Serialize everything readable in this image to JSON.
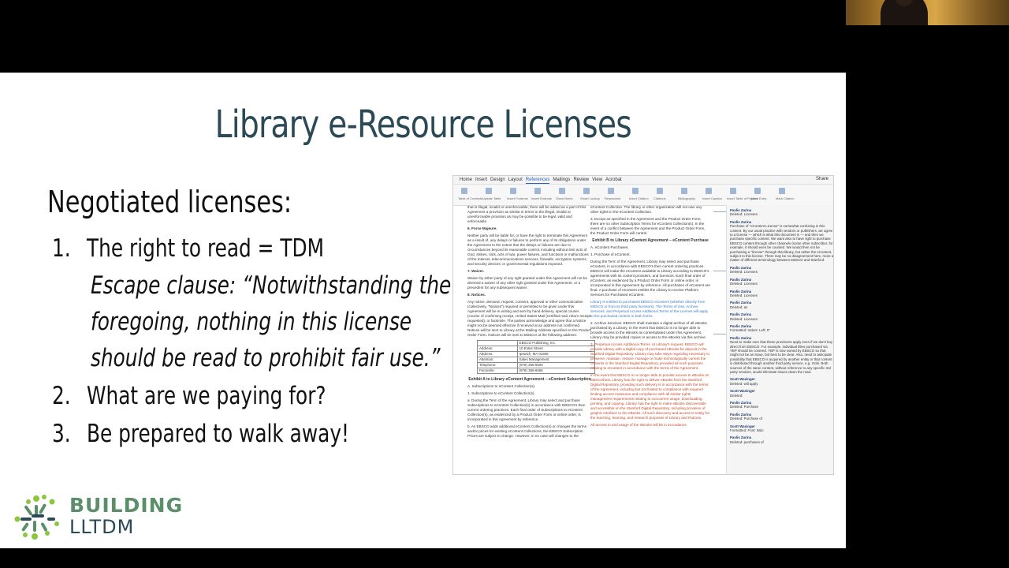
{
  "slide": {
    "title": "Library e-Resource Licenses",
    "heading": "Negotiated licenses:",
    "items": [
      {
        "num": "1.",
        "text": "The right to read = TDM"
      },
      {
        "num": "2.",
        "text": "What are we paying for?"
      },
      {
        "num": "3.",
        "text": "Be prepared to walk away!"
      }
    ],
    "escape_lines": [
      "Escape clause: “Notwithstanding the",
      "foregoing, nothing in this license",
      "should be read to prohibit fair use.”"
    ]
  },
  "logo": {
    "line1": "BUILDING",
    "line2": "LLTDM"
  },
  "document": {
    "tabs": [
      "Home",
      "Insert",
      "Design",
      "Layout",
      "References",
      "Mailings",
      "Review",
      "View",
      "Acrobat"
    ],
    "active_tab": "References",
    "share_label": "Share",
    "tool_labels": [
      "Table of Contents",
      "Update Table",
      "Insert Footnote",
      "Insert Endnote",
      "Show Notes",
      "Smart Lookup",
      "Researcher",
      "Insert Citation",
      "Citations",
      "Bibliography",
      "Insert Caption",
      "Insert Table of Figures",
      "Mark Entry",
      "Mark Citation"
    ],
    "left_col": [
      {
        "cls": "",
        "text": "that is illegal, invalid or unenforceable, there will be added as a part of this Agreement a provision as similar in terms to the illegal, invalid or unenforceable provision as may be possible to be legal, valid and enforceable."
      },
      {
        "cls": "b",
        "text": "6. Force Majeure."
      },
      {
        "cls": "",
        "text": "Neither party will be liable for, or have the right to terminate this Agreement as a result of, any delays or failures to perform any of its obligations under the Agreement to the extent that the delays or failures are due to circumstances beyond its reasonable control, including without limit acts of God, strikes, riots, acts of war, power failures, and functions or malfunctions of the Internet, telecommunications services, firewalls, encryption systems, and security devices; or governmental regulations imposed."
      },
      {
        "cls": "b",
        "text": "7. Waiver."
      },
      {
        "cls": "",
        "text": "Waiver by either party of any right granted under this Agreement will not be deemed a waiver of any other right granted under this Agreement, or a precedent for any subsequent waiver."
      },
      {
        "cls": "b",
        "text": "8. Notices."
      },
      {
        "cls": "",
        "text": "Any notice, demand, request, consent, approval or other communication (collectively, \"Notices\") required or permitted to be given under this Agreement will be in writing and sent by hand delivery, special courier (courier of confirming receipt, United States Mail (certified mail, return receipt requested), or facsimile. The parties acknowledge and agree that a Notice might not be deemed effective if received at an address not confirmed. Notices will be sent to Library at the Mailing Address specified on the Product Order Form. Notices will be sent to EBSCO at the following address:"
      }
    ],
    "address_rows": [
      [
        "",
        "EBSCO Publishing, Inc."
      ],
      [
        "Address:",
        "10 Estes Street"
      ],
      [
        "Address:",
        "Ipswich, MA 01938"
      ],
      [
        "Attention:",
        "Sales Management"
      ],
      [
        "Telephone:",
        "(978) 356-6500"
      ],
      [
        "Facsimile:",
        "(978) 356-6565"
      ]
    ],
    "left_col_2": [
      {
        "cls": "h",
        "text": "Exhibit A to Library eContent Agreement – eContent Subscription"
      },
      {
        "cls": "",
        "text": "A. Subscriptions to eContent Collection(s)."
      },
      {
        "cls": "",
        "text": "1. Subscriptions to eContent Collection(s)."
      },
      {
        "cls": "",
        "text": "a. During the Term of the Agreement, Library may select and purchase Subscriptions to eContent Collection(s) in accordance with EBSCO's then current ordering practices. Each final order of Subscriptions to eContent Collection(s), as evidenced by a Product Order Form or online order, is incorporated in this Agreement by reference."
      },
      {
        "cls": "",
        "text": "b. As EBSCO adds additional eContent Collection(s) or changes the terms and/or prices for existing eContent Collections, the EBSCO Subscription Prices are subject to change. However, in no case will changes to the"
      }
    ],
    "mid_col": [
      {
        "cls": "",
        "text": "eContent Collection. The library or other organization will not own any other rights in the eContent Collection."
      },
      {
        "cls": "",
        "text": "3. Except as specified in the Agreement and the Product Order Form, there are no other Subscription Terms for eContent Collection(s). In the event of a conflict between the Agreement and the Product Order Form, the Product Order Form will control."
      },
      {
        "cls": "h",
        "text": "Exhibit B to Library eContent Agreement – eContent Purchase"
      },
      {
        "cls": "",
        "text": "A. eContent Purchases."
      },
      {
        "cls": "",
        "text": "1. Purchase of eContent."
      },
      {
        "cls": "",
        "text": "During the Term of the Agreement, Library may select and purchase eContent, in accordance with EBSCO's then current ordering practices. EBSCO will make the eContent available to Library according to EBSCO's agreements with its content providers, and licensors. Each final order of eContent, as evidenced by a Product Order Form or online order, is incorporated in this Agreement by reference. All purchases of eContent are final. A purchase of eContent entitles the Library to receive Platform Services for Purchased eContent."
      },
      {
        "cls": "blue",
        "text": "Library is entitled to purchased EBSCO eContent (whether directly from EBSCO or from its third party licensors). The Terms of Use, Archive Services, and Perpetual Access Additional Terms of the License will apply to the purchased content in both forms."
      },
      {
        "cls": "",
        "text": "2. Archive Services. EBSCO shall maintain a digital archive of all eBooks purchased by a Library. In the event that EBSCO is no longer able to provide access to the eBooks as contemplated under this Agreement, Library may be provided copies or access to the eBooks via this archive."
      },
      {
        "cls": "red",
        "text": "3. Perpetual Access Additional Terms. At Library's request, EBSCO will provide Library with a digital copy of purchased eBooks for deposit in the Stanford Digital Repository. Library may take steps regarding necessary to preserve, maintain, restore, manage or make technologically current the contents in the Stanford Digital Repository, provided all such purposes relating to eContent in accordance with the terms of the Agreement."
      },
      {
        "cls": "red",
        "text": "In the event that EBSCO is no longer able to provide access to eBooks on EBSCOhost, Library has the right to deliver eBooks from the Stanford Digital Repository, providing such delivery is in accordance with the terms of the Agreement, including but not limited to compliance with required limiting access measures and compliance with all similar rights management requirements relating to concurrent usage, downloading, printing, and copying. Library has the right to make eBooks discoverable and accessible on the Stanford Digital Repository, including provision of graphic interface to the eBooks. All such discovery and access is solely for the teaching, learning, and research purposes of Library and Patrons."
      },
      {
        "cls": "red",
        "text": "All access to and usage of the eBooks will be in accordance"
      }
    ],
    "comments": [
      {
        "author": "Pavlis Zarina",
        "note": "Deleted: Licenses"
      },
      {
        "author": "Pavlis Zarina",
        "note": "Purchase of \"eContent License\" is somewhat confusing in this context. By our usual practice with vendors or publishers, we agree to a license — which is what this document is — and then we purchase specific content. We want also to have right to purchase EBSCO content through other channels (some other subscriber, for example, it should even be counted. We would then not be purchasing a \"license\" through that library, but rather the eContent, subject to this license. There may be no disagreement here, more a matter of different terminology between EBSCO and Stanford."
      },
      {
        "author": "Pavlis Zarina",
        "note": "Deleted: Licenses"
      },
      {
        "author": "Pavlis Zarina",
        "note": "Deleted: Licenses"
      },
      {
        "author": "Pavlis Zarina",
        "note": "Deleted: Licenses"
      },
      {
        "author": "Pavlis Zarina",
        "note": "Deleted: as"
      },
      {
        "author": "Pavlis Zarina",
        "note": "Deleted: Licenses"
      },
      {
        "author": "Pavlis Zarina",
        "note": "Formatted: Indent: Left: 0\""
      },
      {
        "author": "Pavlis Zarina",
        "note": "Need to make sure that these provisions apply even if we don't buy direct from EBSCO. For example, individual titles purchased via YBP should be covered. YBP is now owned by EBSCO so that might not be an issue, but best to be clear. Also, need to anticipate possibility that EBSCO is acquired by another entity or that content is distributed through another third party service, e.g. Gobi. Both sources of the same content, without reference to any specific 3rd party vendors, would eliminate issues down the road."
      },
      {
        "author": "Scott Wasinger",
        "note": "Deleted: will apply"
      },
      {
        "author": "Scott Wasinger",
        "note": "Deleted:"
      },
      {
        "author": "Pavlis Zarina",
        "note": "Deleted: Purchase"
      },
      {
        "author": "Pavlis Zarina",
        "note": "Deleted: Purchase of"
      },
      {
        "author": "Scott Wasinger",
        "note": "Formatted: Font: Italic"
      },
      {
        "author": "Pavlis Zarina",
        "note": "Deleted: purchases of"
      }
    ]
  }
}
